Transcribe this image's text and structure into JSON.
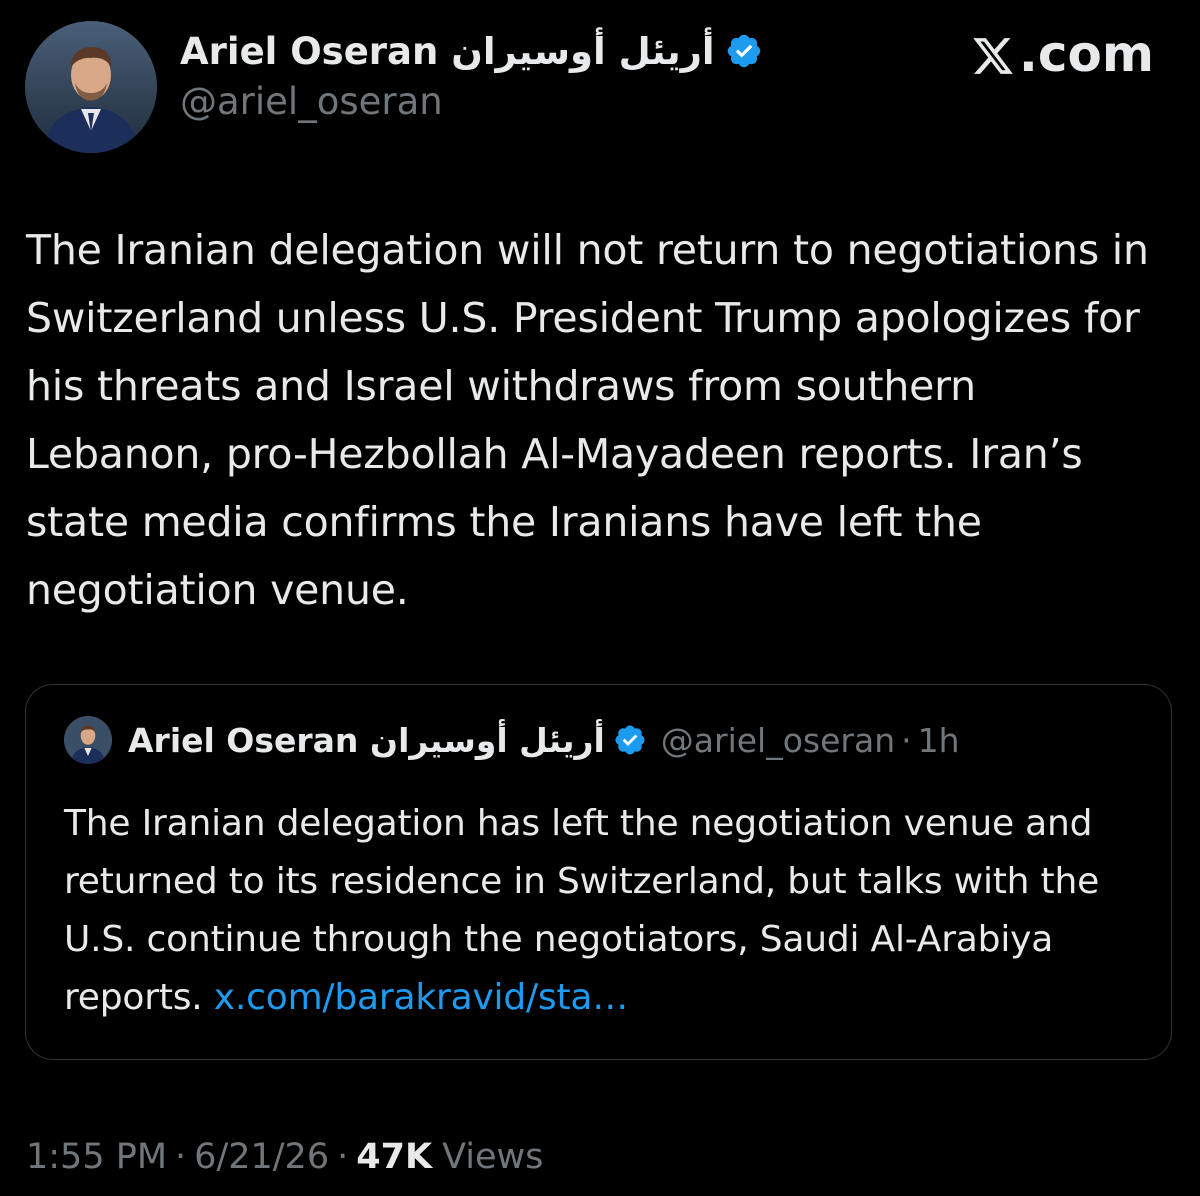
{
  "author": {
    "display_name": "Ariel Oseran أريئل أوسيران",
    "handle": "@ariel_oseran",
    "avatar_icon": "profile-photo",
    "verified_icon": "verified-badge-icon",
    "verified_color": "#1d9bf0"
  },
  "site_logo": {
    "text": ".com",
    "icon": "x-logo-icon"
  },
  "tweet": {
    "text": "The Iranian delegation will not return to negotiations in Switzerland unless U.S. President Trump apologizes for his threats and Israel withdraws from southern Lebanon, pro-Hezbollah Al-Mayadeen reports. Iran’s state media confirms the Iranians have left the negotiation venue."
  },
  "quote": {
    "display_name": "Ariel Oseran أريئل أوسيران",
    "handle": "@ariel_oseran",
    "separator": "·",
    "time": "1h",
    "text": "The Iranian delegation has left the negotiation venue and returned to its residence in Switzerland, but talks with the U.S. continue through the negotiators, Saudi Al-Arabiya reports. ",
    "link_text": "x.com/barakravid/sta…",
    "link_color": "#1d9bf0"
  },
  "meta": {
    "time": "1:55 PM",
    "date": "6/21/26",
    "separator": "·",
    "views_count": "47K",
    "views_label": "Views"
  },
  "colors": {
    "background": "#000000",
    "primary_text": "#e7e9ea",
    "secondary_text": "#71767b",
    "border": "#2f3336",
    "accent": "#1d9bf0"
  }
}
